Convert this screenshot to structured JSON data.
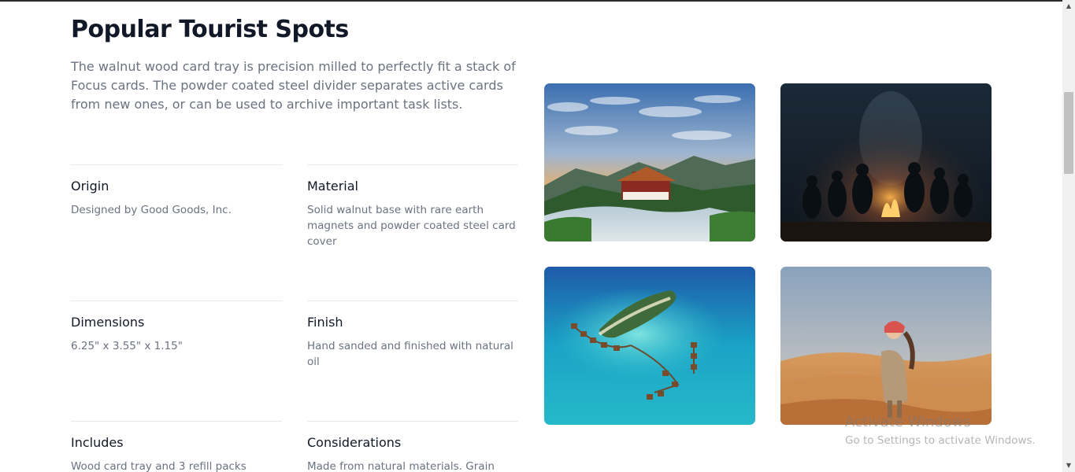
{
  "section": {
    "title": "Popular Tourist Spots",
    "description": "The walnut wood card tray is precision milled to perfectly fit a stack of Focus cards. The powder coated steel divider separates active cards from new ones, or can be used to archive important task lists."
  },
  "specs": [
    {
      "title": "Origin",
      "description": "Designed by Good Goods, Inc."
    },
    {
      "title": "Material",
      "description": "Solid walnut base with rare earth magnets and powder coated steel card cover"
    },
    {
      "title": "Dimensions",
      "description": "6.25\" x 3.55\" x 1.15\""
    },
    {
      "title": "Finish",
      "description": "Hand sanded and finished with natural oil"
    },
    {
      "title": "Includes",
      "description": "Wood card tray and 3 refill packs"
    },
    {
      "title": "Considerations",
      "description": "Made from natural materials. Grain"
    }
  ],
  "watermark": {
    "title": "Activate Windows",
    "subtitle": "Go to Settings to activate Windows."
  }
}
